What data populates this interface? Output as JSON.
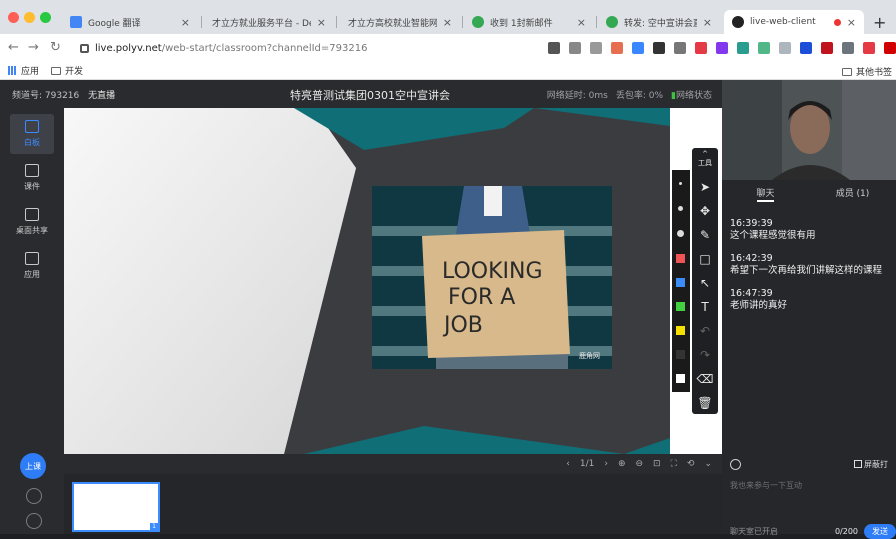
{
  "browser": {
    "tabs": [
      {
        "label": "Google 翻译",
        "color": "#4285f4"
      },
      {
        "label": "才立方就业服务平台 - Defa",
        "color": ""
      },
      {
        "label": "才立方高校就业智能网络形",
        "color": ""
      },
      {
        "label": "收到 1封新邮件",
        "color": "#34a853"
      },
      {
        "label": "转发: 空中宣讲会直播通知",
        "color": "#34a853"
      },
      {
        "label": "live-web-client",
        "color": "#222222"
      }
    ],
    "address": {
      "host": "live.polyv.net",
      "path": "/web-start/classroom?channelId=793216"
    },
    "bookmarks": {
      "apps": "应用",
      "dev": "开发",
      "other": "其他书签"
    }
  },
  "header": {
    "channel": "频道号: 793216",
    "live_status": "无直播",
    "title": "特亮普测试集团0301空中宣讲会",
    "latency": "网络延时: 0ms",
    "packet_loss": "丢包率: 0%",
    "net_state": "网络状态"
  },
  "sidebar": {
    "items": [
      {
        "label": "白板",
        "icon": "whiteboard-icon"
      },
      {
        "label": "课件",
        "icon": "courseware-icon"
      },
      {
        "label": "桌面共享",
        "icon": "screen-share-icon"
      },
      {
        "label": "应用",
        "icon": "apps-icon"
      }
    ],
    "start_label": "上课"
  },
  "slide": {
    "image_text": "LOOKING FOR A JOB",
    "watermark": "鹿角网"
  },
  "tools": {
    "header": "工具",
    "colors": [
      "#f05454",
      "#3b8cf6",
      "#40d040",
      "#f5e000",
      "#333333",
      "#ffffff"
    ]
  },
  "board_footer": {
    "page": "1/1"
  },
  "thumb": {
    "number": "1"
  },
  "panel": {
    "tabs": [
      "聊天",
      "成员 (1)"
    ],
    "messages": [
      {
        "time": "16:39:39",
        "text": "这个课程感觉很有用"
      },
      {
        "time": "16:42:39",
        "text": "希望下一次再给我们讲解这样的课程"
      },
      {
        "time": "16:47:39",
        "text": "老师讲的真好"
      }
    ],
    "block_label": "屏蔽打",
    "input_placeholder": "我也来参与一下互动",
    "chat_status": "聊天室已开启",
    "counter": "0/200",
    "send_label": "发送"
  }
}
